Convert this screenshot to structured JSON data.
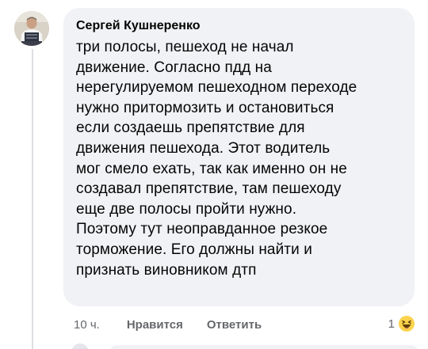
{
  "comment": {
    "author": "Сергей Кушнеренко",
    "text": "три полосы, пешеход не начал\nдвижение. Согласно пдд на\nнерегулируемом пешеходном переходе\nнужно притормозить и остановиться\nесли создаешь препятствие для\nдвижения пешехода. Этот водитель\nмог смело ехать, так как именно он не\nсоздавал препятствие, там пешеходу\nеще две полосы пройти нужно.\nПоэтому тут неоправданное резкое\nторможение. Его должны найти и\nпризнать виновником дтп",
    "timestamp": "10 ч.",
    "like_label": "Нравится",
    "reply_label": "Ответить",
    "reaction_count": "1",
    "reaction_icon": "haha-emoji-icon"
  },
  "colors": {
    "bubble_bg": "#f0f2f5",
    "text": "#050505",
    "meta": "#65676b"
  }
}
